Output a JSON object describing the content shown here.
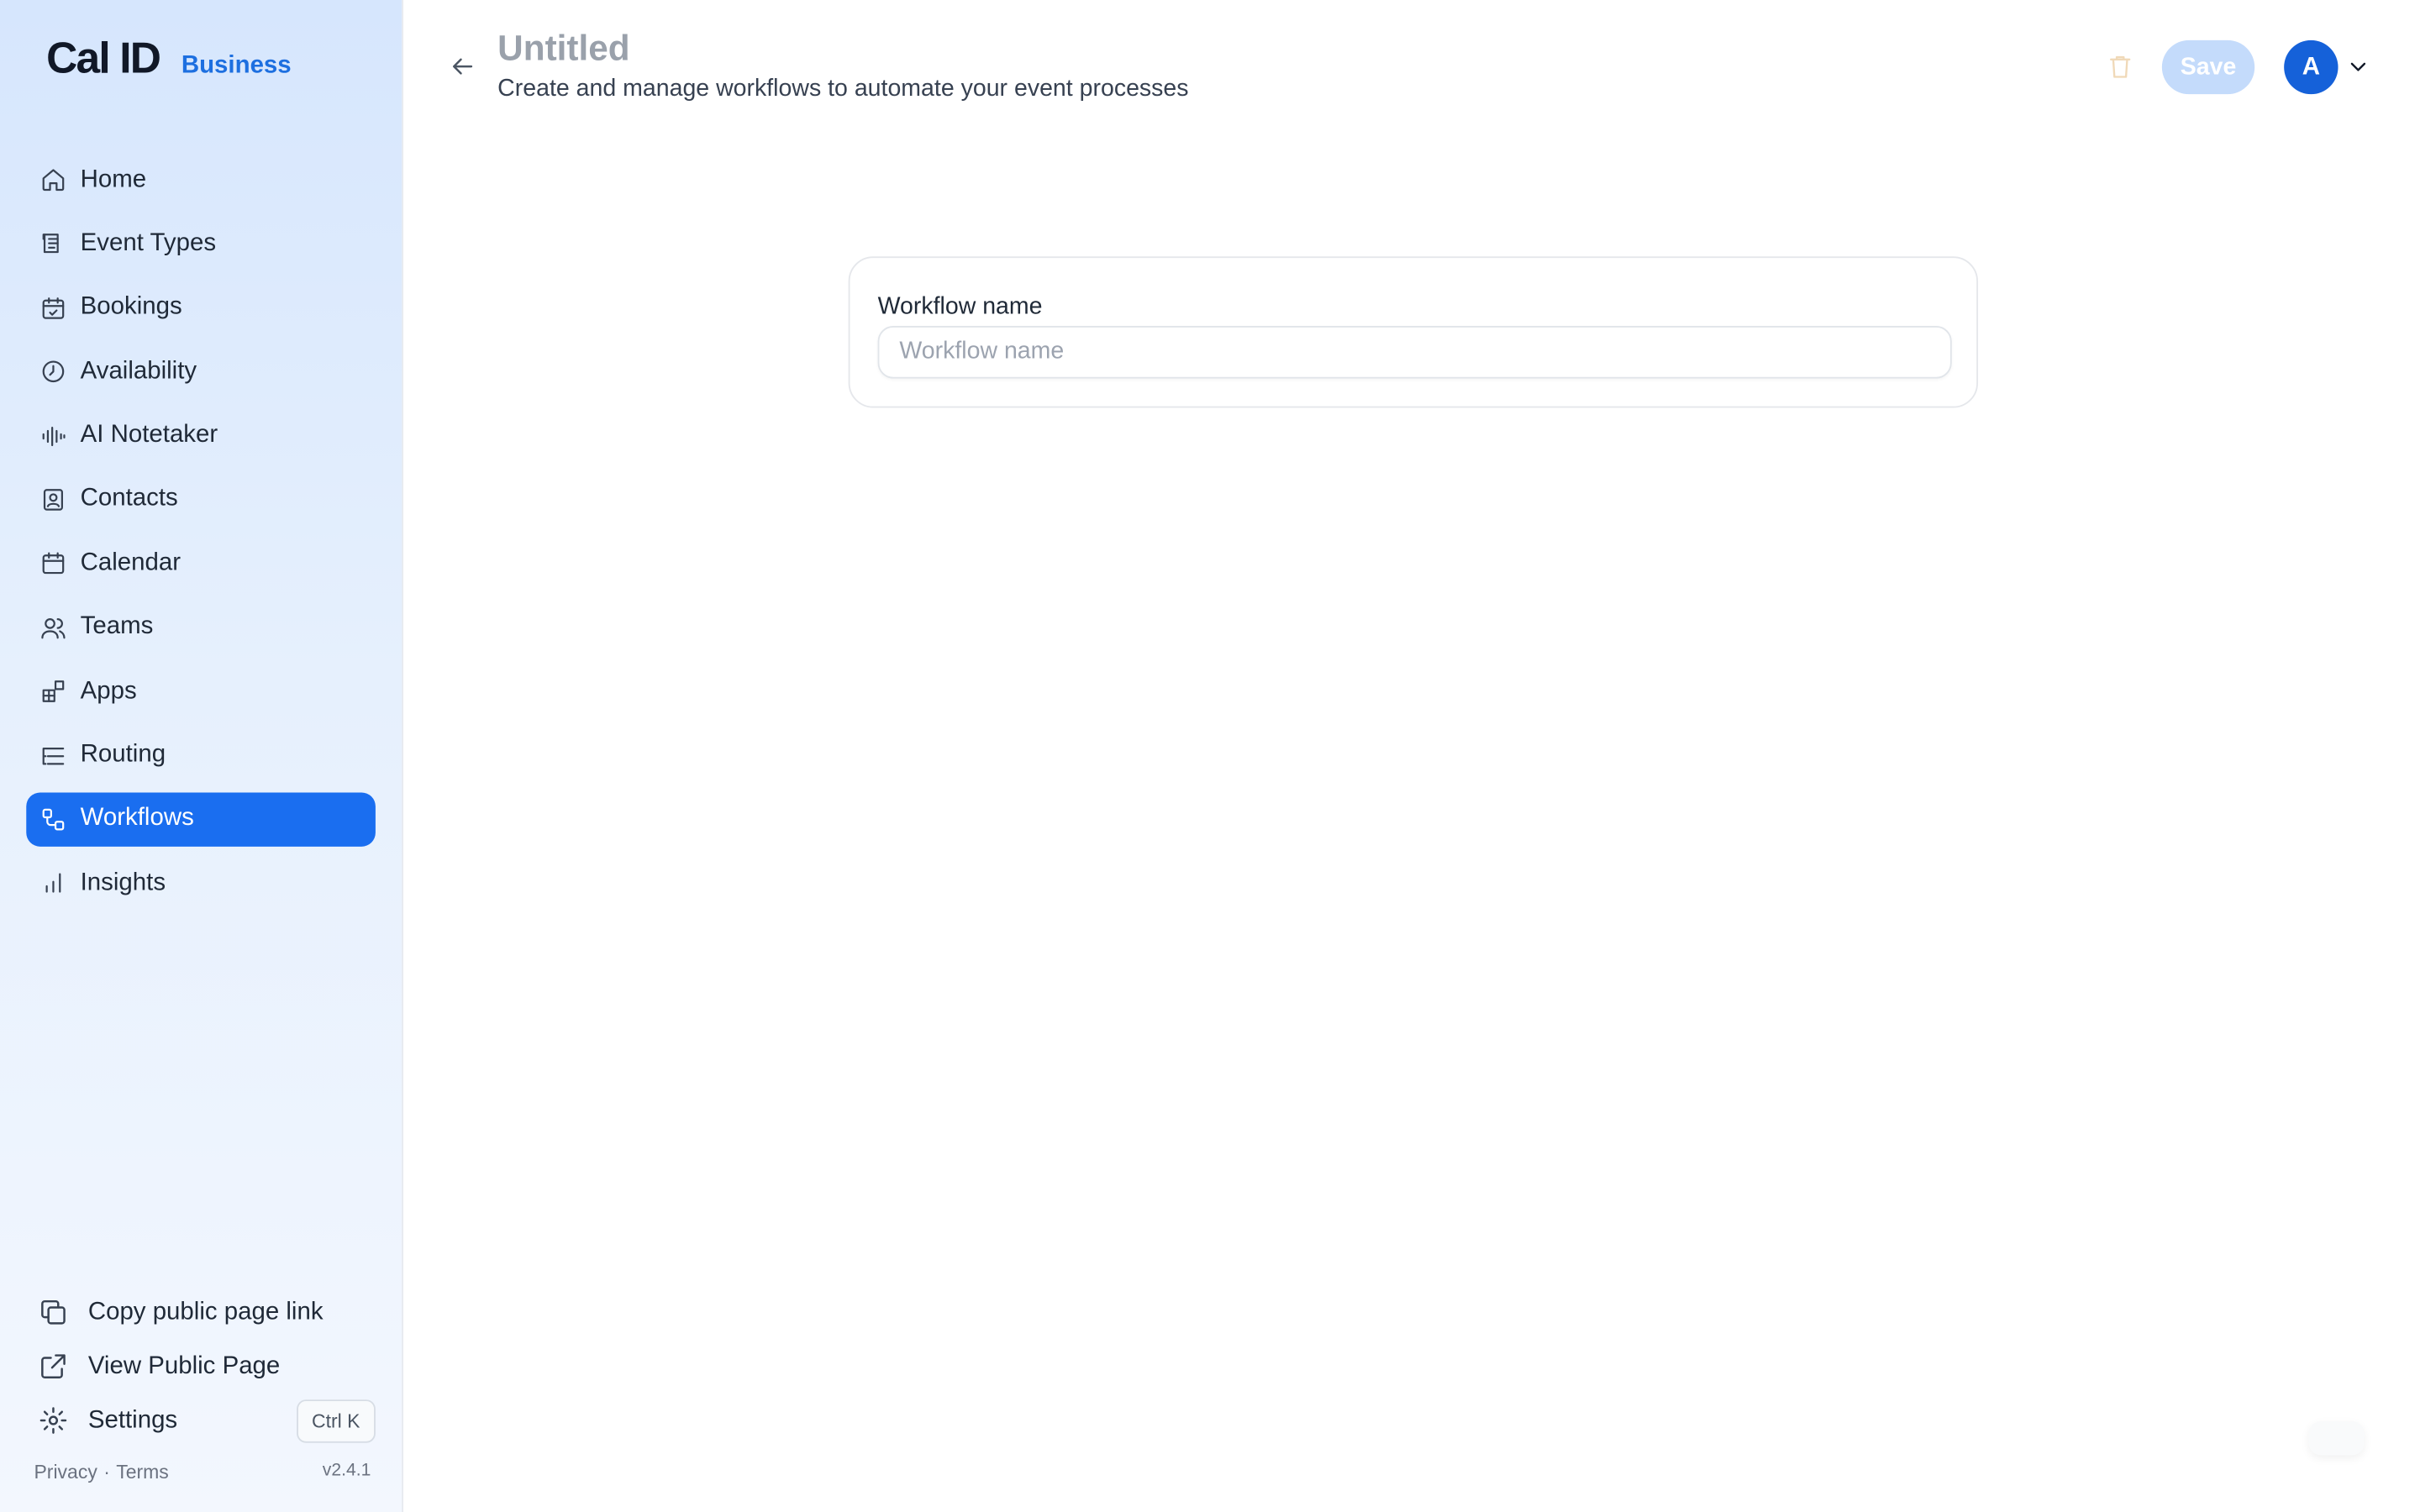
{
  "brand": {
    "logo": "Cal ID",
    "plan": "Business"
  },
  "sidebar": {
    "items": [
      {
        "label": "Home",
        "icon": "home-icon"
      },
      {
        "label": "Event Types",
        "icon": "event-types-icon"
      },
      {
        "label": "Bookings",
        "icon": "calendar-check-icon"
      },
      {
        "label": "Availability",
        "icon": "clock-icon"
      },
      {
        "label": "AI Notetaker",
        "icon": "audio-wave-icon"
      },
      {
        "label": "Contacts",
        "icon": "contact-card-icon"
      },
      {
        "label": "Calendar",
        "icon": "calendar-icon"
      },
      {
        "label": "Teams",
        "icon": "users-icon"
      },
      {
        "label": "Apps",
        "icon": "apps-grid-icon"
      },
      {
        "label": "Routing",
        "icon": "routing-list-icon"
      },
      {
        "label": "Workflows",
        "icon": "workflow-icon",
        "active": true
      },
      {
        "label": "Insights",
        "icon": "bar-chart-icon"
      }
    ],
    "bottom": {
      "copy_link": "Copy public page link",
      "view_public": "View Public Page",
      "settings": "Settings",
      "shortcut": "Ctrl K"
    },
    "footer": {
      "privacy": "Privacy",
      "separator": "·",
      "terms": "Terms",
      "version": "v2.4.1"
    }
  },
  "header": {
    "title": "Untitled",
    "subtitle": "Create and manage workflows to automate your event processes",
    "save_label": "Save",
    "avatar_initial": "A"
  },
  "form": {
    "workflow_name_label": "Workflow name",
    "workflow_name_placeholder": "Workflow name",
    "workflow_name_value": ""
  },
  "colors": {
    "accent": "#1a6ef0",
    "save_disabled": "#c4dbfb",
    "avatar": "#1561d9",
    "title_muted": "#9aa1ab"
  }
}
